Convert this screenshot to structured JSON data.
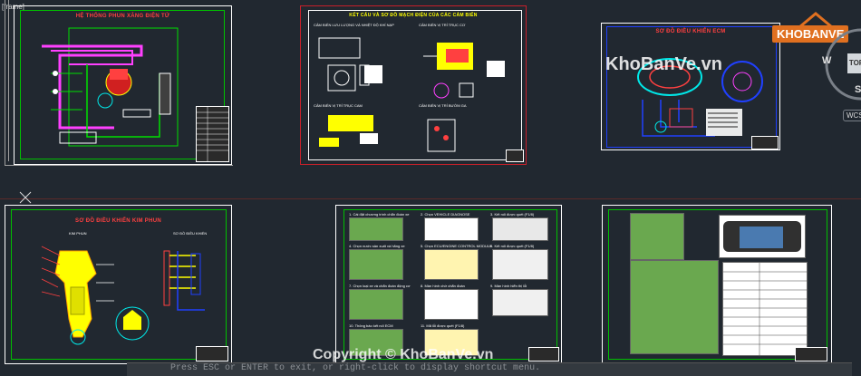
{
  "viewport": {
    "frame_label": "[frame]"
  },
  "sheets": [
    {
      "id": "s1",
      "title": "HỆ THỐNG PHUN XĂNG ĐIỆN TỬ"
    },
    {
      "id": "s2",
      "title": "KẾT CẤU VÀ SƠ ĐỒ MẠCH ĐIỆN CỦA CÁC CẢM BIẾN",
      "labels": [
        "CẢM BIẾN LƯU LƯỢNG VÀ NHIỆT ĐỘ KHÍ NẠP",
        "CẢM BIẾN VỊ TRÍ TRỤC CƠ",
        "CẢM BIẾN VỊ TRÍ TRỤC CAM",
        "CẢM BIẾN VỊ TRÍ BƯỚM GA"
      ]
    },
    {
      "id": "s3",
      "title": "SƠ ĐỒ ĐIỀU KHIỂN ECM"
    },
    {
      "id": "s4",
      "title": "SƠ ĐỒ ĐIỀU KHIỂN KIM PHUN",
      "labels": [
        "KIM PHUN",
        "SƠ ĐỒ ĐIỀU KHIỂN"
      ]
    },
    {
      "id": "s5",
      "steps": [
        "1. Cài đặt chương trình chẩn đoán xe",
        "2. Chọn VEHICLE DIAGNOSE",
        "3. Kết nối được quét (F1/8)",
        "4. Chọn nước sản xuất và hãng xe",
        "5. Chọn ECU/ENGINE CONTROL MODULE",
        "6. Kết nối được quét (F1/8)",
        "7. Chọn loại xe và chẩn đoán động cơ",
        "8. Màn hình chờ chẩn đoán",
        "9. Màn hình hiển thị lỗi",
        "10. Thông báo kết nối ECM",
        "11. Mã lỗi được quét (F1/8)"
      ]
    },
    {
      "id": "s6"
    }
  ],
  "watermarks": {
    "center": "KhoBanVe.vn",
    "bottom": "Copyright © KhoBanVe.vn",
    "logo": "KHOBANVE"
  },
  "viewcube": {
    "top_label": "TOP",
    "west": "W",
    "south": "S",
    "wcs": "WCS"
  },
  "command_line": {
    "prompt": "Press ESC or ENTER to exit, or right-click to display shortcut menu."
  },
  "colors": {
    "background": "#212830",
    "sheet_border_red": "#c8202a",
    "green": "#00e000",
    "yellow": "#ffff00",
    "cyan": "#00e8e8",
    "magenta": "#ff40ff",
    "blue": "#2040ff"
  }
}
